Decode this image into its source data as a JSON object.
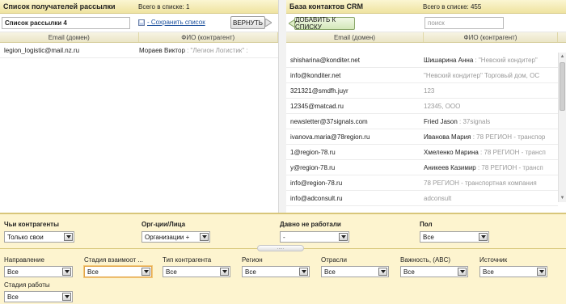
{
  "left": {
    "title": "Список получателей рассылки",
    "count_text": "Всего в списке: 1",
    "list_name": "Список рассылки 4",
    "save_link": "- Сохранить список",
    "return_button": "ВЕРНУТЬ",
    "columns": [
      "Email (домен)",
      "ФИО (контрагент)"
    ],
    "rows": [
      {
        "email": "legion_logistic@mail.nz.ru",
        "name": "Мораев Виктор",
        "company": " : \"Легион Логистик\" : "
      }
    ]
  },
  "right": {
    "title": "База контактов CRM",
    "count_text": "Всего в списке: 455",
    "add_button": "ДОБАВИТЬ К СПИСКУ",
    "search_placeholder": "поиск",
    "columns": [
      "Email (домен)",
      "ФИО (контрагент)"
    ],
    "rows": [
      {
        "email": "shisharina@konditer.net",
        "name": "Шишарина Анна",
        "company": " : \"Невский кондитер\""
      },
      {
        "email": "info@konditer.net",
        "name": "",
        "company": "\"Невский кондитер\" Торговый дом, ОС"
      },
      {
        "email": "321321@smdfh.juyr",
        "name": "",
        "company": "123"
      },
      {
        "email": "12345@matcad.ru",
        "name": "",
        "company": "12345, ООО"
      },
      {
        "email": "newsletter@37signals.com",
        "name": "Fried Jason",
        "company": " : 37signals"
      },
      {
        "email": "ivanova.maria@78region.ru",
        "name": "Иванова Мария",
        "company": " : 78 РЕГИОН - транспор"
      },
      {
        "email": "1@region-78.ru",
        "name": "Хмеленко Марина",
        "company": " : 78 РЕГИОН - трансп"
      },
      {
        "email": "y@region-78.ru",
        "name": "Аникеев Казимир",
        "company": " : 78 РЕГИОН - трансп"
      },
      {
        "email": "info@region-78.ru",
        "name": "",
        "company": "78 РЕГИОН - транспортная компания"
      },
      {
        "email": "info@adconsult.ru",
        "name": "",
        "company": "adconsult"
      }
    ]
  },
  "filters": {
    "row1": [
      {
        "label": "Чьи контрагенты",
        "value": "Только свои"
      },
      {
        "label": "Орг-ции/Лица",
        "value": "Организации +"
      },
      {
        "label": "Давно не работали",
        "value": "-"
      },
      {
        "label": "Пол",
        "value": "Все"
      }
    ],
    "row2": [
      {
        "label": "Направление",
        "value": "Все"
      },
      {
        "label": "Стадия взаимоот ...",
        "value": "Все"
      },
      {
        "label": "Тип контрагента",
        "value": "Все"
      },
      {
        "label": "Регион",
        "value": "Все"
      },
      {
        "label": "Отрасли",
        "value": "Все"
      },
      {
        "label": "Важность, (ABC)",
        "value": "Все"
      },
      {
        "label": "Источник",
        "value": "Все"
      }
    ],
    "row3": [
      {
        "label": "Стадия работы",
        "value": "Все"
      }
    ],
    "grip_text": "....."
  },
  "colors": {
    "header": "#efe3a0",
    "filters_bg": "#fdf4cf",
    "add_button": "#dfeec8",
    "link": "#1a4f9c"
  }
}
